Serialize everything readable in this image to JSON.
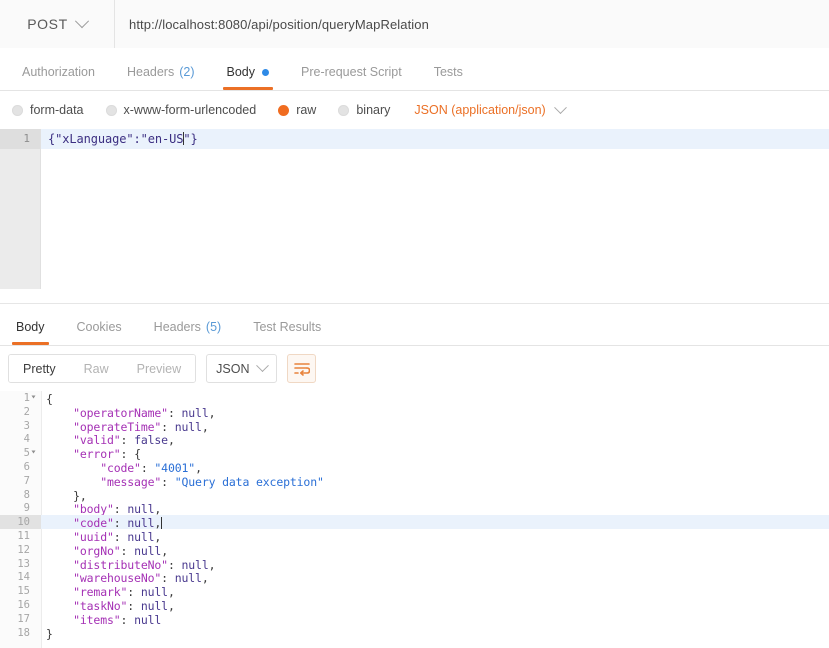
{
  "request": {
    "method": "POST",
    "url": "http://localhost:8080/api/position/queryMapRelation",
    "tabs": [
      {
        "label": "Authorization",
        "count": "",
        "active": false,
        "dot": false
      },
      {
        "label": "Headers",
        "count": "(2)",
        "active": false,
        "dot": false
      },
      {
        "label": "Body",
        "count": "",
        "active": true,
        "dot": true
      },
      {
        "label": "Pre-request Script",
        "count": "",
        "active": false,
        "dot": false
      },
      {
        "label": "Tests",
        "count": "",
        "active": false,
        "dot": false
      }
    ],
    "body_types": [
      {
        "label": "form-data",
        "selected": false
      },
      {
        "label": "x-www-form-urlencoded",
        "selected": false
      },
      {
        "label": "raw",
        "selected": true
      },
      {
        "label": "binary",
        "selected": false
      }
    ],
    "content_type": "JSON (application/json)",
    "editor": {
      "line_number": "1",
      "code_before_caret": "{\"xLanguage\":\"en-US",
      "code_after_caret": "\"}"
    }
  },
  "response": {
    "tabs": [
      {
        "label": "Body",
        "count": "",
        "active": true
      },
      {
        "label": "Cookies",
        "count": "",
        "active": false
      },
      {
        "label": "Headers",
        "count": "(5)",
        "active": false
      },
      {
        "label": "Test Results",
        "count": "",
        "active": false
      }
    ],
    "view_modes": [
      {
        "label": "Pretty",
        "active": true
      },
      {
        "label": "Raw",
        "active": false
      },
      {
        "label": "Preview",
        "active": false
      }
    ],
    "format": "JSON",
    "wrap_icon": "word-wrap-icon",
    "lines": [
      {
        "no": "1",
        "fold": true,
        "hl": false,
        "caret": false,
        "tokens": [
          {
            "t": "{",
            "c": "p"
          }
        ]
      },
      {
        "no": "2",
        "fold": false,
        "hl": false,
        "caret": false,
        "tokens": [
          {
            "t": "    \"operatorName\"",
            "c": "k"
          },
          {
            "t": ": ",
            "c": "p"
          },
          {
            "t": "null",
            "c": "n"
          },
          {
            "t": ",",
            "c": "p"
          }
        ]
      },
      {
        "no": "3",
        "fold": false,
        "hl": false,
        "caret": false,
        "tokens": [
          {
            "t": "    \"operateTime\"",
            "c": "k"
          },
          {
            "t": ": ",
            "c": "p"
          },
          {
            "t": "null",
            "c": "n"
          },
          {
            "t": ",",
            "c": "p"
          }
        ]
      },
      {
        "no": "4",
        "fold": false,
        "hl": false,
        "caret": false,
        "tokens": [
          {
            "t": "    \"valid\"",
            "c": "k"
          },
          {
            "t": ": ",
            "c": "p"
          },
          {
            "t": "false",
            "c": "n"
          },
          {
            "t": ",",
            "c": "p"
          }
        ]
      },
      {
        "no": "5",
        "fold": true,
        "hl": false,
        "caret": false,
        "tokens": [
          {
            "t": "    \"error\"",
            "c": "k"
          },
          {
            "t": ": {",
            "c": "p"
          }
        ]
      },
      {
        "no": "6",
        "fold": false,
        "hl": false,
        "caret": false,
        "tokens": [
          {
            "t": "        \"code\"",
            "c": "k"
          },
          {
            "t": ": ",
            "c": "p"
          },
          {
            "t": "\"4001\"",
            "c": "s"
          },
          {
            "t": ",",
            "c": "p"
          }
        ]
      },
      {
        "no": "7",
        "fold": false,
        "hl": false,
        "caret": false,
        "tokens": [
          {
            "t": "        \"message\"",
            "c": "k"
          },
          {
            "t": ": ",
            "c": "p"
          },
          {
            "t": "\"Query data exception\"",
            "c": "s"
          }
        ]
      },
      {
        "no": "8",
        "fold": false,
        "hl": false,
        "caret": false,
        "tokens": [
          {
            "t": "    },",
            "c": "p"
          }
        ]
      },
      {
        "no": "9",
        "fold": false,
        "hl": false,
        "caret": false,
        "tokens": [
          {
            "t": "    \"body\"",
            "c": "k"
          },
          {
            "t": ": ",
            "c": "p"
          },
          {
            "t": "null",
            "c": "n"
          },
          {
            "t": ",",
            "c": "p"
          }
        ]
      },
      {
        "no": "10",
        "fold": false,
        "hl": true,
        "caret": true,
        "tokens": [
          {
            "t": "    \"code\"",
            "c": "k"
          },
          {
            "t": ": ",
            "c": "p"
          },
          {
            "t": "null",
            "c": "n"
          },
          {
            "t": ",",
            "c": "p"
          }
        ]
      },
      {
        "no": "11",
        "fold": false,
        "hl": false,
        "caret": false,
        "tokens": [
          {
            "t": "    \"uuid\"",
            "c": "k"
          },
          {
            "t": ": ",
            "c": "p"
          },
          {
            "t": "null",
            "c": "n"
          },
          {
            "t": ",",
            "c": "p"
          }
        ]
      },
      {
        "no": "12",
        "fold": false,
        "hl": false,
        "caret": false,
        "tokens": [
          {
            "t": "    \"orgNo\"",
            "c": "k"
          },
          {
            "t": ": ",
            "c": "p"
          },
          {
            "t": "null",
            "c": "n"
          },
          {
            "t": ",",
            "c": "p"
          }
        ]
      },
      {
        "no": "13",
        "fold": false,
        "hl": false,
        "caret": false,
        "tokens": [
          {
            "t": "    \"distributeNo\"",
            "c": "k"
          },
          {
            "t": ": ",
            "c": "p"
          },
          {
            "t": "null",
            "c": "n"
          },
          {
            "t": ",",
            "c": "p"
          }
        ]
      },
      {
        "no": "14",
        "fold": false,
        "hl": false,
        "caret": false,
        "tokens": [
          {
            "t": "    \"warehouseNo\"",
            "c": "k"
          },
          {
            "t": ": ",
            "c": "p"
          },
          {
            "t": "null",
            "c": "n"
          },
          {
            "t": ",",
            "c": "p"
          }
        ]
      },
      {
        "no": "15",
        "fold": false,
        "hl": false,
        "caret": false,
        "tokens": [
          {
            "t": "    \"remark\"",
            "c": "k"
          },
          {
            "t": ": ",
            "c": "p"
          },
          {
            "t": "null",
            "c": "n"
          },
          {
            "t": ",",
            "c": "p"
          }
        ]
      },
      {
        "no": "16",
        "fold": false,
        "hl": false,
        "caret": false,
        "tokens": [
          {
            "t": "    \"taskNo\"",
            "c": "k"
          },
          {
            "t": ": ",
            "c": "p"
          },
          {
            "t": "null",
            "c": "n"
          },
          {
            "t": ",",
            "c": "p"
          }
        ]
      },
      {
        "no": "17",
        "fold": false,
        "hl": false,
        "caret": false,
        "tokens": [
          {
            "t": "    \"items\"",
            "c": "k"
          },
          {
            "t": ": ",
            "c": "p"
          },
          {
            "t": "null",
            "c": "n"
          }
        ]
      },
      {
        "no": "18",
        "fold": false,
        "hl": false,
        "caret": false,
        "tokens": [
          {
            "t": "}",
            "c": "p"
          }
        ]
      }
    ]
  },
  "colors": {
    "accent_orange": "#eb7026",
    "link_blue": "#5a9ad6",
    "dot_blue": "#2e8ae6",
    "json_key": "#a531b5",
    "json_string": "#2a6fd6",
    "active_line": "#eaf2fc"
  }
}
